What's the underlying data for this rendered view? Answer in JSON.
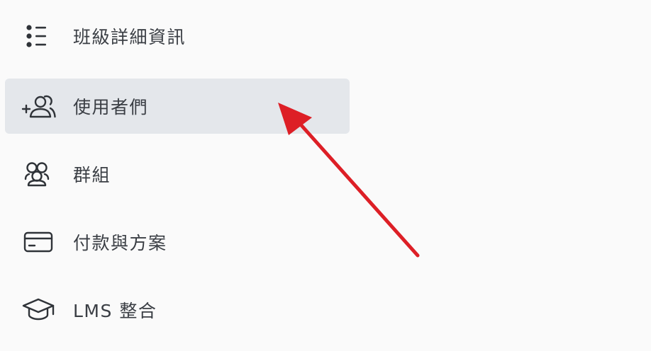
{
  "menu": {
    "items": [
      {
        "label": "班級詳細資訊",
        "icon": "list-icon",
        "selected": false
      },
      {
        "label": "使用者們",
        "icon": "add-user-icon",
        "selected": true
      },
      {
        "label": "群組",
        "icon": "group-icon",
        "selected": false
      },
      {
        "label": "付款與方案",
        "icon": "credit-card-icon",
        "selected": false
      },
      {
        "label": "LMS 整合",
        "icon": "graduation-cap-icon",
        "selected": false
      }
    ]
  },
  "colors": {
    "background": "#fafafa",
    "selected_background": "#e4e7eb",
    "text": "#3a3e44",
    "icon": "#2f3338",
    "annotation_arrow": "#dd1f26"
  }
}
